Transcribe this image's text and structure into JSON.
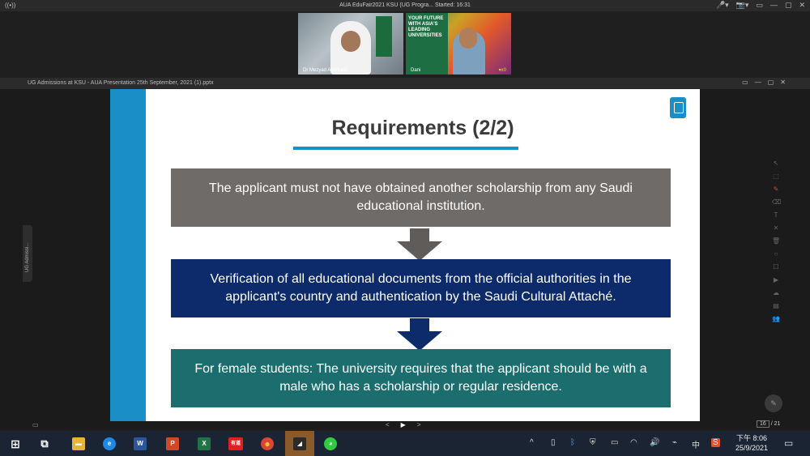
{
  "meeting": {
    "title": "AUA EduFair2021 KSU (UG Progra...  Started: 16:31",
    "rec_icon": "((•))",
    "controls": [
      "🎤▾",
      "📷▾",
      "▭",
      "—",
      "▢",
      "✕"
    ]
  },
  "videos": [
    {
      "name": "Dr Mezyad Alterkawi"
    },
    {
      "name": "Dani",
      "poster_text": "YOUR FUTURE WITH ASIA'S LEADING UNIVERSITIES",
      "signal": "▾x0"
    }
  ],
  "presentation": {
    "window_title": "UG Admissions at KSU - AUA Presentation 25th September, 2021 (1).pptx",
    "window_controls": [
      "▭",
      "—",
      "▢",
      "✕"
    ],
    "side_tab": "UG Admissi..."
  },
  "slide": {
    "title": "Requirements (2/2)",
    "boxes": [
      {
        "text": "The applicant must not have obtained another scholarship from any Saudi educational institution.",
        "color": "#6e6b68"
      },
      {
        "text": "Verification of all educational documents from the official authorities in the applicant's country and authentication by the Saudi Cultural Attaché.",
        "color": "#0d2a6b"
      },
      {
        "text": "For female students: The university requires that the applicant should be with a male who has a scholarship or regular residence.",
        "color": "#1c6e6e"
      }
    ],
    "arrow_colors": [
      "#5f5c5a",
      "#0d2a6b"
    ],
    "accent": "#1a8fc7"
  },
  "tools": [
    "↖",
    "⬚",
    "✎",
    "⌫",
    "T",
    "✕",
    "🗑",
    "○",
    "☐",
    "▶",
    "☁",
    "▤",
    "👥"
  ],
  "nav": {
    "prev": "<",
    "play": "▶",
    "next": ">",
    "current_page": "16",
    "total_pages": "/ 21",
    "left_icon": "▭"
  },
  "taskbar": {
    "apps": [
      {
        "name": "start",
        "glyph": "⊞",
        "color": "transparent"
      },
      {
        "name": "taskview",
        "glyph": "⧉",
        "color": "transparent"
      },
      {
        "name": "file-explorer",
        "glyph": "▬",
        "color": "#e8b33a"
      },
      {
        "name": "internet-explorer",
        "glyph": "e",
        "color": "#1e88e5"
      },
      {
        "name": "word",
        "glyph": "W",
        "color": "#2b579a"
      },
      {
        "name": "powerpoint",
        "glyph": "P",
        "color": "#d24726"
      },
      {
        "name": "excel",
        "glyph": "X",
        "color": "#217346"
      },
      {
        "name": "youdao",
        "glyph": "有道",
        "color": "#e02020"
      },
      {
        "name": "chrome",
        "glyph": "●",
        "color": "#4caf50"
      },
      {
        "name": "voov-meeting",
        "glyph": "◢",
        "color": "#2b2b2b"
      },
      {
        "name": "wechat",
        "glyph": "◕",
        "color": "#2ecc40"
      }
    ],
    "tray": {
      "icons": [
        "^",
        "▯",
        "ᛒ",
        "⛨",
        "▭",
        "◠",
        "🔊",
        "⌁",
        "中",
        "S"
      ],
      "time": "下午 8:06",
      "date": "25/9/2021",
      "notification": "▭"
    }
  }
}
